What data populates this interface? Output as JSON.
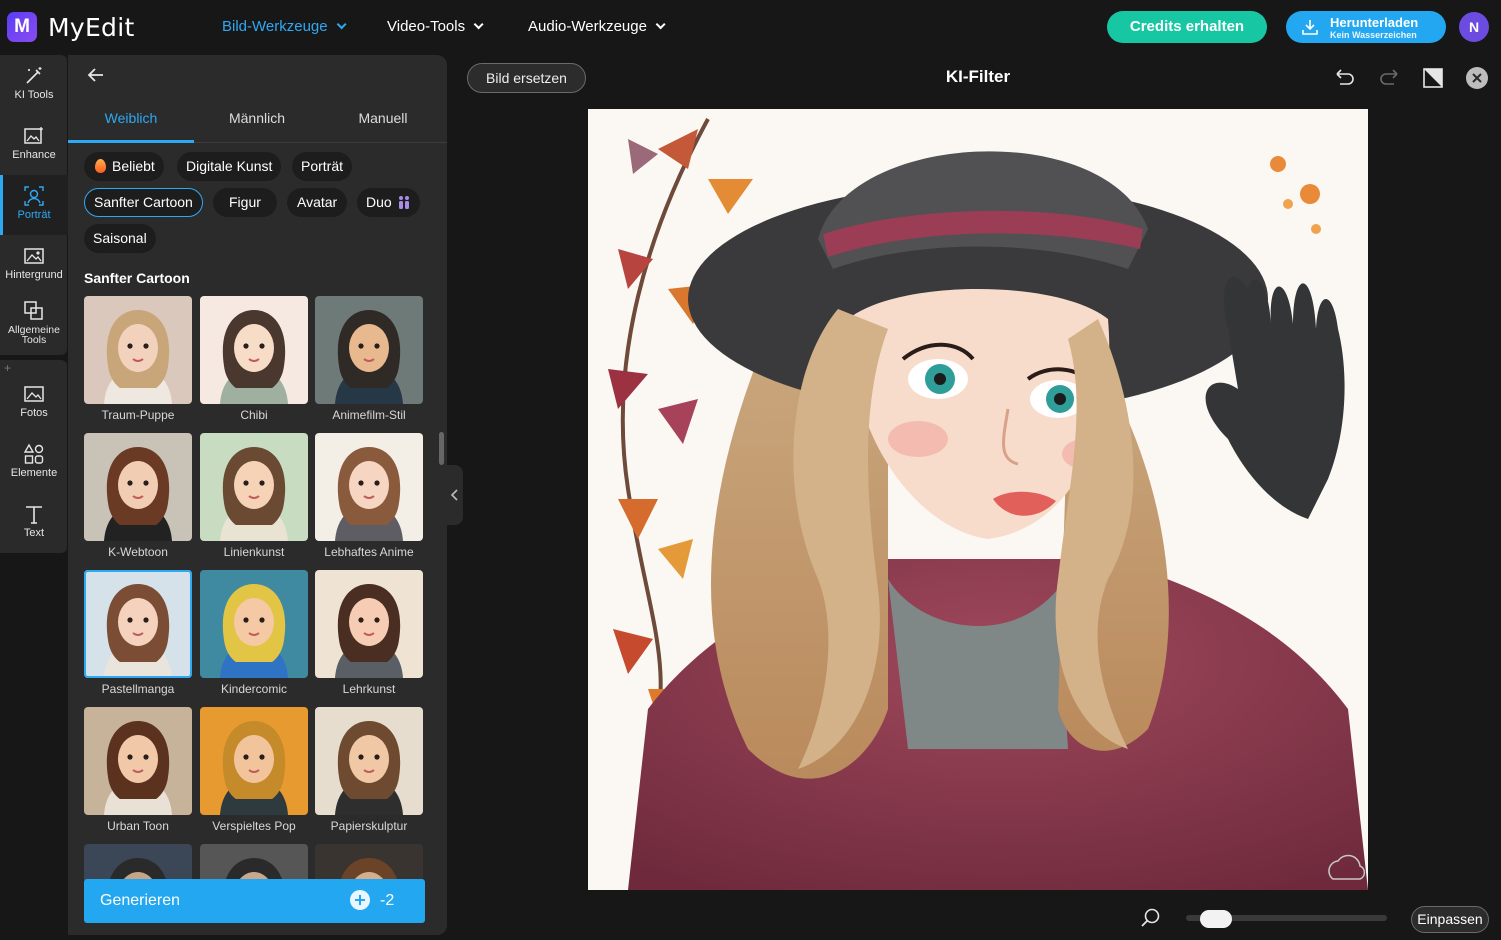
{
  "app": {
    "logo_letter": "M",
    "name": "MyEdit",
    "user_initial": "N"
  },
  "nav": [
    {
      "label": "Bild-Werkzeuge",
      "active": true
    },
    {
      "label": "Video-Tools"
    },
    {
      "label": "Audio-Werkzeuge"
    }
  ],
  "header_buttons": {
    "credits": "Credits erhalten",
    "download": "Herunterladen",
    "download_sub": "Kein Wasserzeichen"
  },
  "rail": [
    {
      "label": "KI Tools",
      "icon": "magic-wand-icon"
    },
    {
      "label": "Enhance",
      "icon": "enhance-image-icon"
    },
    {
      "label": "Porträt",
      "icon": "portrait-icon",
      "active": true
    },
    {
      "label": "Hintergrund",
      "icon": "background-icon"
    },
    {
      "label": "Allgemeine Tools",
      "icon": "general-tools-icon"
    },
    {
      "label": "Fotos",
      "icon": "photos-icon"
    },
    {
      "label": "Elemente",
      "icon": "elements-icon"
    },
    {
      "label": "Text",
      "icon": "text-icon"
    }
  ],
  "panel": {
    "tabs": [
      "Weiblich",
      "Männlich",
      "Manuell"
    ],
    "active_tab": "Weiblich",
    "chips": [
      "Beliebt",
      "Digitale Kunst",
      "Porträt",
      "Sanfter Cartoon",
      "Figur",
      "Avatar",
      "Duo",
      "Saisonal"
    ],
    "selected_chip": "Sanfter Cartoon",
    "section_title": "Sanfter Cartoon",
    "styles": [
      {
        "label": "Traum-Puppe",
        "bg": "#d9c8bb",
        "hair": "#c9a57a",
        "skin": "#f3d2bd",
        "cloth": "#efe8e0"
      },
      {
        "label": "Chibi",
        "bg": "#f6e9e2",
        "hair": "#4a382f",
        "skin": "#f7dcc8",
        "cloth": "#9fb0a0"
      },
      {
        "label": "Animefilm-Stil",
        "bg": "#6d7a78",
        "hair": "#2f2a26",
        "skin": "#e8b88f",
        "cloth": "#263846"
      },
      {
        "label": "K-Webtoon",
        "bg": "#c9c2b6",
        "hair": "#6a3a24",
        "skin": "#f1cdb3",
        "cloth": "#222222"
      },
      {
        "label": "Linienkunst",
        "bg": "#c7dcc0",
        "hair": "#6b4a33",
        "skin": "#f6d2b7",
        "cloth": "#e8e3d2"
      },
      {
        "label": "Lebhaftes Anime",
        "bg": "#f3eee6",
        "hair": "#8a5a3c",
        "skin": "#f6d5c2",
        "cloth": "#5d5d63"
      },
      {
        "label": "Pastellmanga",
        "bg": "#d6e2ea",
        "hair": "#7a4d34",
        "skin": "#f4d2bd",
        "cloth": "#e9e4dc",
        "selected": true
      },
      {
        "label": "Kindercomic",
        "bg": "#3f8aa0",
        "hair": "#e3c545",
        "skin": "#f4c9a4",
        "cloth": "#2f74c4"
      },
      {
        "label": "Lehrkunst",
        "bg": "#efe4d4",
        "hair": "#4a2e22",
        "skin": "#f6cdb4",
        "cloth": "#5a5f66"
      },
      {
        "label": "Urban Toon",
        "bg": "#c6b39a",
        "hair": "#5b321e",
        "skin": "#f1c9a9",
        "cloth": "#e9e1d5"
      },
      {
        "label": "Verspieltes Pop",
        "bg": "#e79a2f",
        "hair": "#c58a2a",
        "skin": "#f2c49b",
        "cloth": "#2f3a3f"
      },
      {
        "label": "Papierskulptur",
        "bg": "#e7ddcf",
        "hair": "#6d4a30",
        "skin": "#f0c8a6",
        "cloth": "#2e2e2e"
      },
      {
        "label": "",
        "bg": "#3b4657",
        "hair": "#2a2a2a",
        "skin": "#c8a487",
        "cloth": "#2f2f2f"
      },
      {
        "label": "",
        "bg": "#565656",
        "hair": "#2a2a2a",
        "skin": "#c9a88e",
        "cloth": "#3b3b3b"
      },
      {
        "label": "",
        "bg": "#3a3430",
        "hair": "#6b4428",
        "skin": "#d8ad8c",
        "cloth": "#2e2e2e"
      }
    ],
    "generate_label": "Generieren",
    "generate_cost": "-2"
  },
  "canvas": {
    "replace_label": "Bild ersetzen",
    "title": "KI-Filter",
    "fit_label": "Einpassen",
    "zoom_level": 0.08
  },
  "colors": {
    "accent": "#2fa8f3",
    "credits": "#17c7a4",
    "download": "#22a7f0",
    "panel": "#2b2b2b"
  }
}
